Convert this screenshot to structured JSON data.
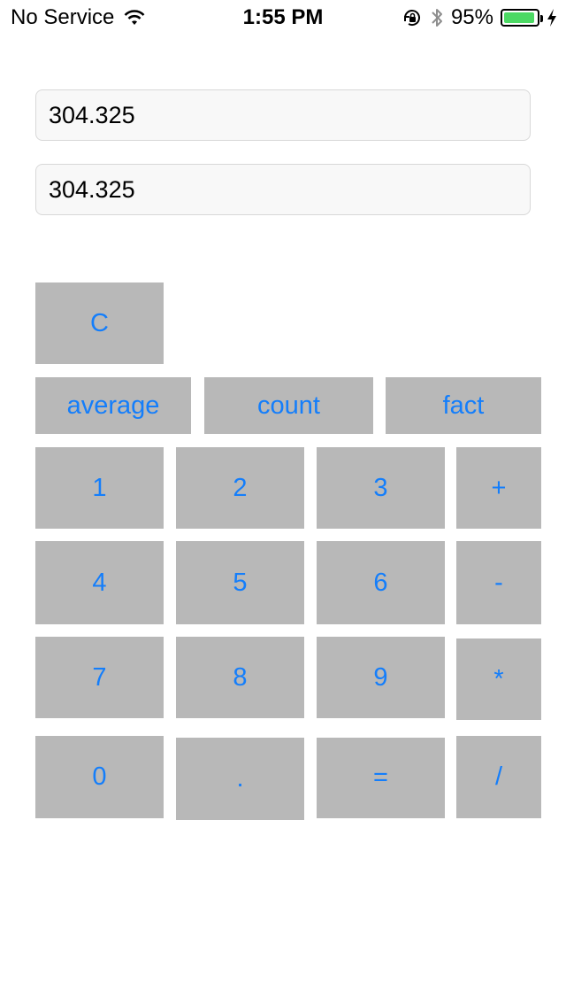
{
  "status_bar": {
    "carrier": "No Service",
    "time": "1:55 PM",
    "battery_percent": "95%",
    "battery_level": 0.95,
    "icons": [
      "wifi-icon",
      "rotation-lock-icon",
      "bluetooth-icon",
      "battery-icon",
      "charging-bolt-icon"
    ]
  },
  "fields": {
    "first_value": "304.325",
    "second_value": "304.325"
  },
  "keys": {
    "clear": "C",
    "average": "average",
    "count": "count",
    "fact": "fact",
    "one": "1",
    "two": "2",
    "three": "3",
    "plus": "+",
    "four": "4",
    "five": "5",
    "six": "6",
    "minus": "-",
    "seven": "7",
    "eight": "8",
    "nine": "9",
    "multiply": "*",
    "zero": "0",
    "dot": ".",
    "equals": "=",
    "divide": "/"
  },
  "colors": {
    "key_background": "#b8b8b8",
    "key_text": "#147efb",
    "battery_fill": "#4cd964"
  }
}
